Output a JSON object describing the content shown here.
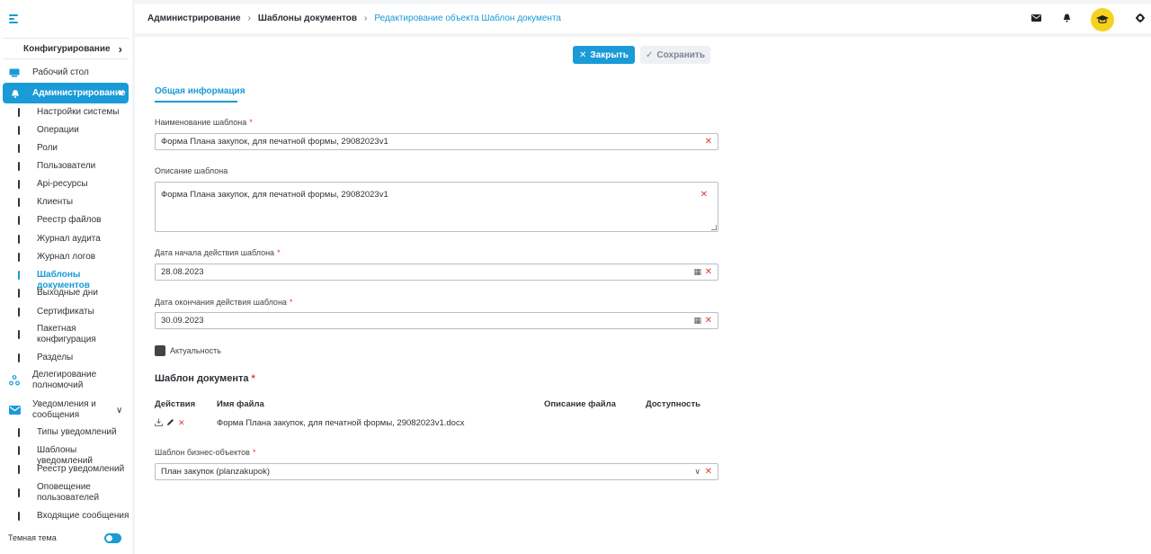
{
  "sidebar": {
    "config_label": "Конфигурирование",
    "desktop": "Рабочий стол",
    "admin": "Администрирование",
    "admin_items": [
      "Настройки системы",
      "Операции",
      "Роли",
      "Пользователи",
      "Api-ресурсы",
      "Клиенты",
      "Реестр файлов",
      "Журнал аудита",
      "Журнал логов",
      "Шаблоны документов",
      "Выходные дни",
      "Сертификаты",
      "Пакетная конфигурация",
      "Разделы"
    ],
    "delegation": "Делегирование полномочий",
    "notifications": "Уведомления и сообщения",
    "notif_items": [
      "Типы уведомлений",
      "Шаблоны уведомлений",
      "Реестр уведомлений",
      "Оповещение пользователей",
      "Входящие сообщения"
    ],
    "theme_label": "Темная тема"
  },
  "header": {
    "crumb1": "Администрирование",
    "crumb2": "Шаблоны документов",
    "crumb3": "Редактирование объекта Шаблон документа"
  },
  "toolbar": {
    "close_label": "Закрыть",
    "save_label": "Сохранить"
  },
  "tab": "Общая информация",
  "form": {
    "name_label": "Наименование шаблона",
    "name_value": "Форма Плана закупок, для печатной формы, 29082023v1",
    "desc_label": "Описание шаблона",
    "desc_value": "Форма Плана закупок, для печатной формы, 29082023v1",
    "start_label": "Дата начала действия шаблона",
    "start_value": "28.08.2023",
    "end_label": "Дата окончания действия шаблона",
    "end_value": "30.09.2023",
    "active_label": "Актуальность",
    "doc_section": "Шаблон документа",
    "table_headers": {
      "actions": "Действия",
      "file": "Имя файла",
      "desc": "Описание файла",
      "access": "Доступность"
    },
    "file_name": "Форма Плана закупок, для печатной формы, 29082023v1.docx",
    "biz_label": "Шаблон бизнес-объектов",
    "biz_value": "План закупок (planzakupok)"
  },
  "colors": {
    "accent": "#1a9ad6",
    "required": "#e53935"
  },
  "icons": [
    "menu-icon",
    "monitor-icon",
    "bell-icon",
    "mail-icon",
    "graduation-cap-icon",
    "gear-icon",
    "calendar-icon",
    "download-icon",
    "edit-icon",
    "close-icon",
    "delegation-icon"
  ]
}
